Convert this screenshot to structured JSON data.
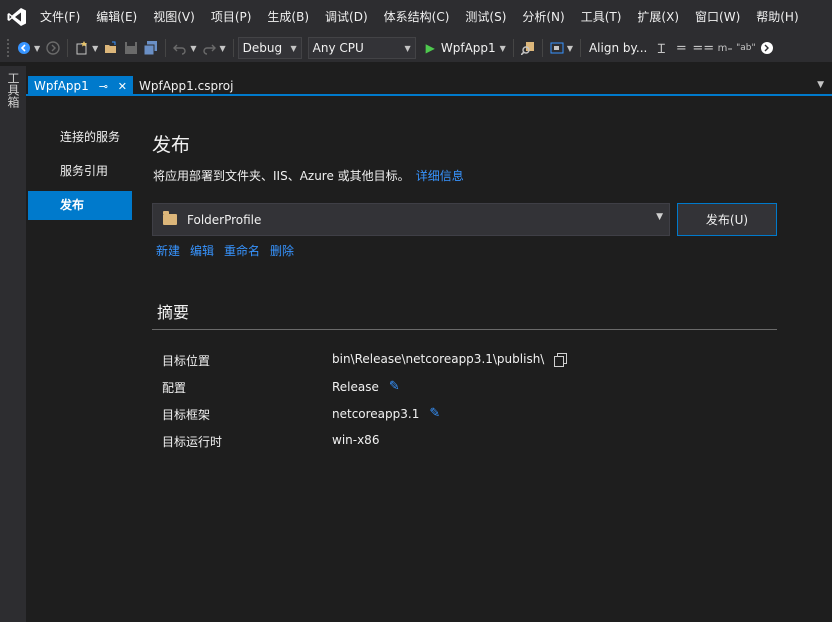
{
  "menu": {
    "items": [
      "文件(F)",
      "编辑(E)",
      "视图(V)",
      "项目(P)",
      "生成(B)",
      "调试(D)",
      "体系结构(C)",
      "测试(S)",
      "分析(N)",
      "工具(T)",
      "扩展(X)",
      "窗口(W)",
      "帮助(H)"
    ]
  },
  "toolbar": {
    "config": "Debug",
    "platform": "Any CPU",
    "run_target": "WpfApp1",
    "align_label": "Align by..."
  },
  "toolstrip": {
    "label": "工具箱"
  },
  "tabs": {
    "active": "WpfApp1",
    "inactive": "WpfApp1.csproj"
  },
  "sidenav": {
    "items": [
      "连接的服务",
      "服务引用",
      "发布"
    ],
    "active_index": 2
  },
  "publish": {
    "title": "发布",
    "description": "将应用部署到文件夹、IIS、Azure 或其他目标。",
    "details_link": "详细信息",
    "profile": "FolderProfile",
    "publish_button": "发布(U)",
    "actions": [
      "新建",
      "编辑",
      "重命名",
      "删除"
    ]
  },
  "summary": {
    "title": "摘要",
    "rows": [
      {
        "label": "目标位置",
        "value": "bin\\Release\\netcoreapp3.1\\publish\\",
        "icon": "copy-icon"
      },
      {
        "label": "配置",
        "value": "Release",
        "icon": "edit-icon"
      },
      {
        "label": "目标框架",
        "value": "netcoreapp3.1",
        "icon": "edit-icon"
      },
      {
        "label": "目标运行时",
        "value": "win-x86",
        "icon": ""
      }
    ]
  },
  "colors": {
    "accent": "#007acc",
    "link": "#3794ff",
    "background": "#1e1e1e",
    "chrome": "#2d2d30"
  }
}
